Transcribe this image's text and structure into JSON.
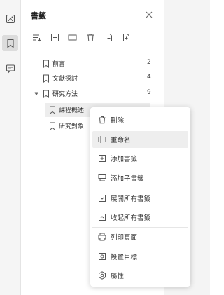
{
  "panel": {
    "title": "書籤"
  },
  "rail": {
    "items": [
      {
        "icon": "image-bookmark-icon",
        "active": false
      },
      {
        "icon": "bookmark-icon",
        "active": true
      },
      {
        "icon": "comment-icon",
        "active": false
      }
    ]
  },
  "toolbar": {
    "buttons": [
      {
        "icon": "sort-icon"
      },
      {
        "icon": "add-bookmark-icon"
      },
      {
        "icon": "rename-icon"
      },
      {
        "icon": "delete-icon"
      },
      {
        "icon": "export-icon"
      },
      {
        "icon": "import-icon"
      }
    ]
  },
  "bookmarks": [
    {
      "label": "前言",
      "count": "2"
    },
    {
      "label": "文獻探討",
      "count": "4"
    },
    {
      "label": "研究方法",
      "count": "9",
      "expanded": true,
      "children": [
        {
          "label": "課程概述",
          "selected": true
        },
        {
          "label": "研究對象"
        }
      ]
    }
  ],
  "context_menu": {
    "items": [
      {
        "label": "刪除",
        "icon": "trash-icon"
      },
      {
        "label": "重命名",
        "icon": "rename-icon",
        "hover": true
      },
      {
        "label": "添加書籤",
        "icon": "add-bookmark-icon"
      },
      {
        "label": "添加子書籤",
        "icon": "add-child-bookmark-icon"
      },
      {
        "label": "展開所有書籤",
        "icon": "expand-all-icon"
      },
      {
        "label": "收起所有書籤",
        "icon": "collapse-all-icon"
      },
      {
        "label": "列印頁面",
        "icon": "print-icon"
      },
      {
        "label": "設置目標",
        "icon": "set-target-icon"
      },
      {
        "label": "屬性",
        "icon": "properties-icon"
      }
    ]
  },
  "colors": {
    "rail_bg": "#f5f5f5",
    "rail_active": "#dcdcdc",
    "selected_bg": "#ededed",
    "icon": "#555555"
  }
}
